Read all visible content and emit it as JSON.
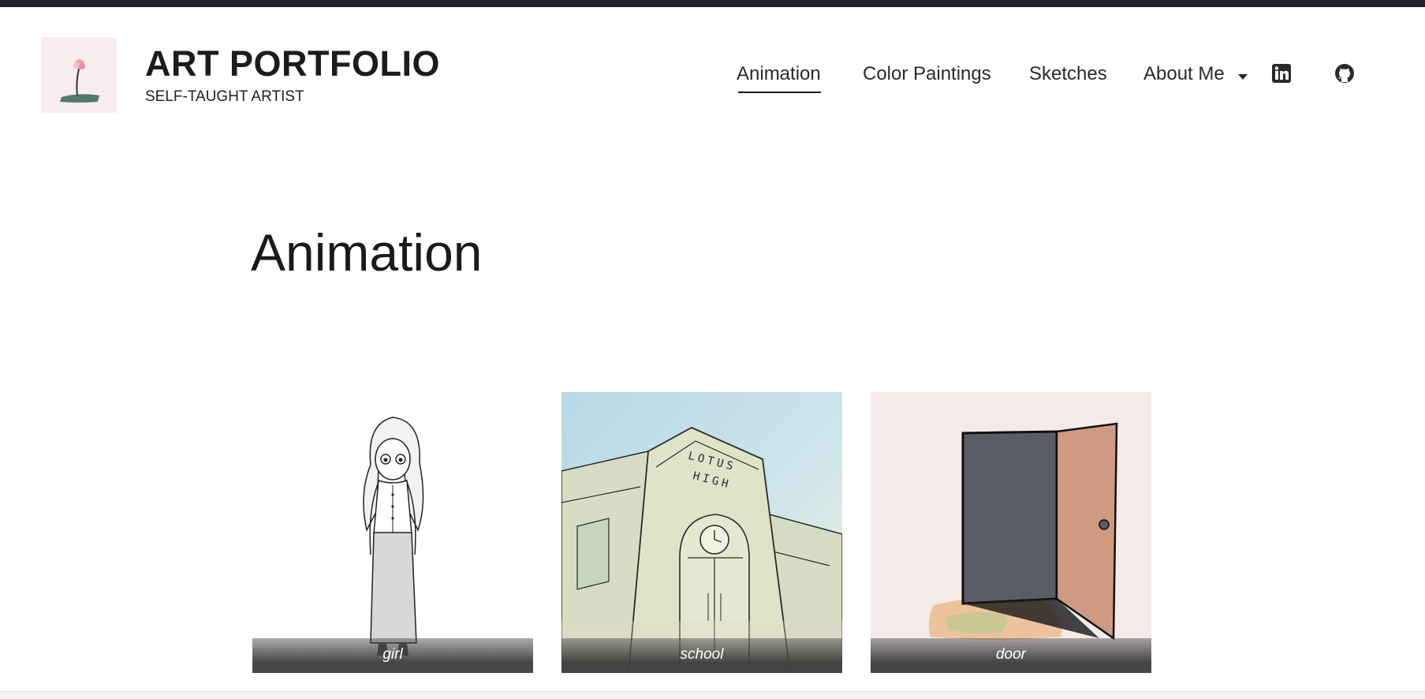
{
  "site": {
    "title": "ART PORTFOLIO",
    "tagline": "SELF-TAUGHT ARTIST",
    "logo_icon": "flower-logo-icon"
  },
  "nav": {
    "items": [
      {
        "label": "Animation",
        "active": true
      },
      {
        "label": "Color Paintings",
        "active": false
      },
      {
        "label": "Sketches",
        "active": false
      },
      {
        "label": "About Me",
        "active": false,
        "dropdown": true
      }
    ],
    "social": [
      {
        "icon": "linkedin-icon"
      },
      {
        "icon": "github-icon"
      }
    ]
  },
  "page": {
    "heading": "Animation"
  },
  "gallery": {
    "cards": [
      {
        "caption": "girl",
        "image": "girl-sketch"
      },
      {
        "caption": "school",
        "image": "school-building-painting",
        "sign_line1": "LOTUS",
        "sign_line2": "HIGH"
      },
      {
        "caption": "door",
        "image": "open-door-painting"
      }
    ]
  },
  "colors": {
    "topbar": "#202226",
    "logo_bg": "#f9ecee",
    "caption_overlay": "#3c3c3c",
    "door_bg": "#f5eaea",
    "door_dark": "#5a5c66",
    "door_panel": "#d09a80"
  }
}
